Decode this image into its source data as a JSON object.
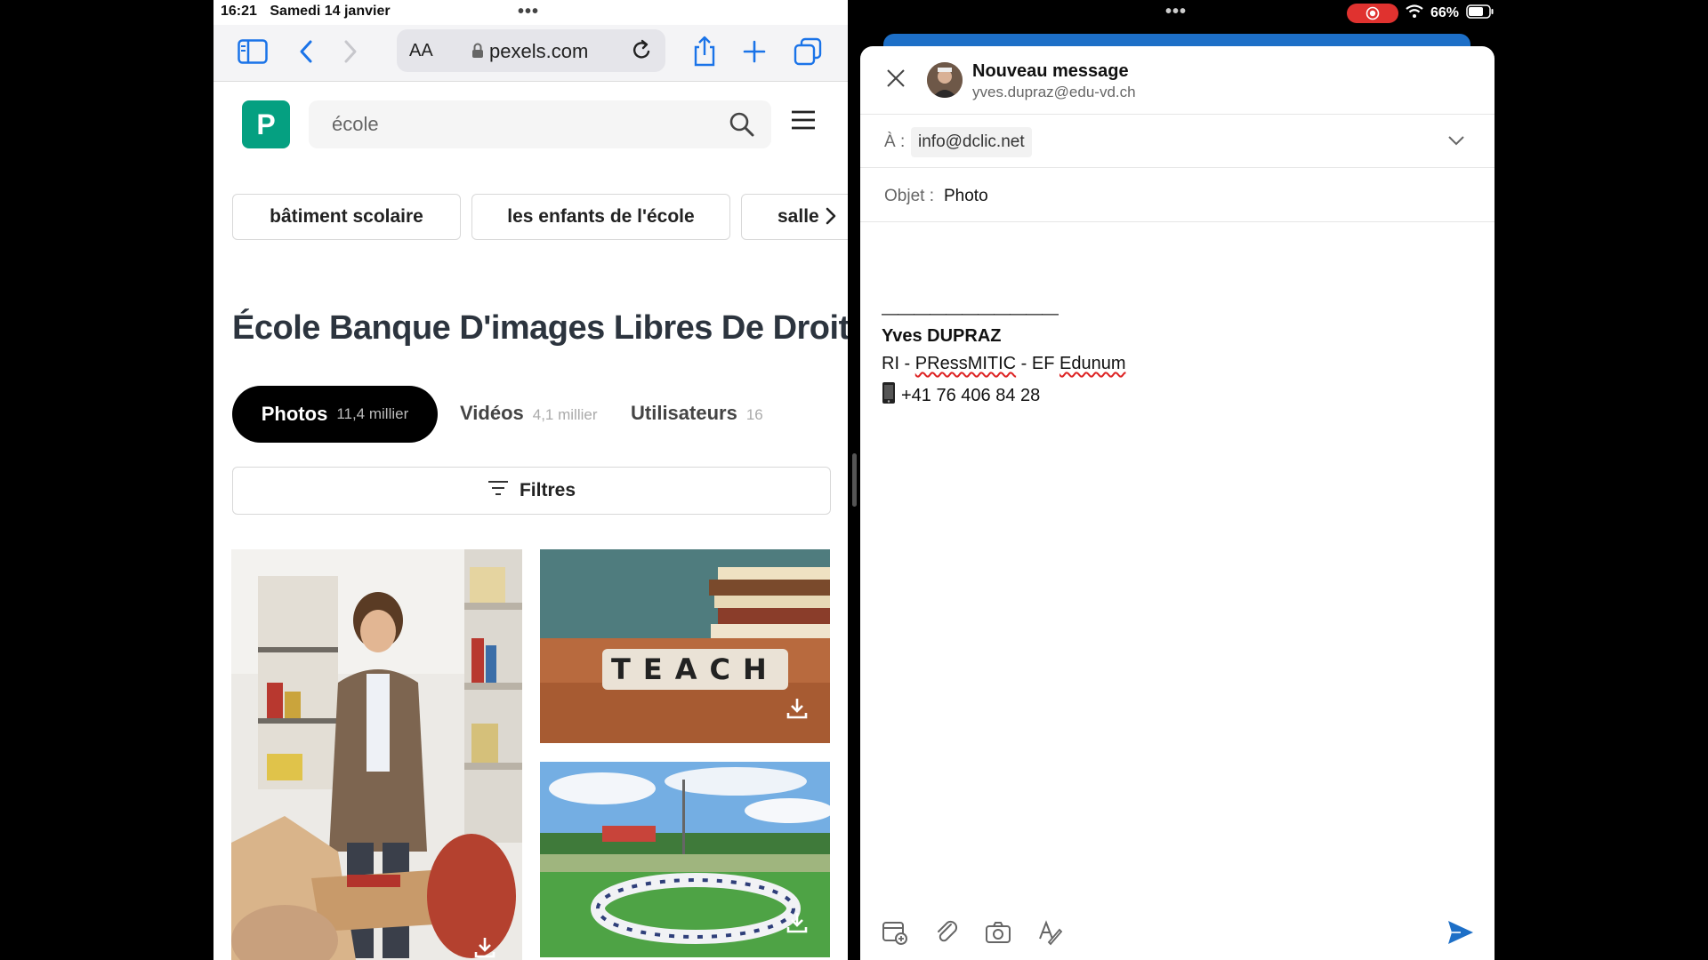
{
  "status_bar": {
    "time": "16:21",
    "date": "Samedi 14 janvier",
    "multitask_dots": "•••",
    "battery": "66%"
  },
  "browser": {
    "aa_label": "AA",
    "url": "pexels.com"
  },
  "site": {
    "logo_letter": "P",
    "search_value": "école",
    "chips": [
      "bâtiment scolaire",
      "les enfants de l'école",
      "salle"
    ],
    "page_title": "École Banque D'images Libres De Droit",
    "tabs": [
      {
        "label": "Photos",
        "count": "11,4 millier"
      },
      {
        "label": "Vidéos",
        "count": "4,1 millier"
      },
      {
        "label": "Utilisateurs",
        "count": "16"
      }
    ],
    "filters_label": "Filtres",
    "photo_texts": {
      "teach_word": "TEACH"
    }
  },
  "mail": {
    "header_title": "Nouveau message",
    "sender_email": "yves.dupraz@edu-vd.ch",
    "to_label": "À :",
    "to_value": "info@dclic.net",
    "subject_label": "Objet :",
    "subject_value": "Photo",
    "signature": {
      "separator": "———————————",
      "name": "Yves DUPRAZ",
      "role_prefix": "RI - ",
      "role_org1": "PRessMITIC",
      "role_mid": " - EF ",
      "role_org2": "Edunum",
      "phone": "+41 76 406 84 28"
    }
  },
  "colors": {
    "brand_green": "#05a081",
    "safari_blue": "#1a73e8",
    "mail_blue": "#1d6fc7",
    "record_red": "#e0322f"
  }
}
